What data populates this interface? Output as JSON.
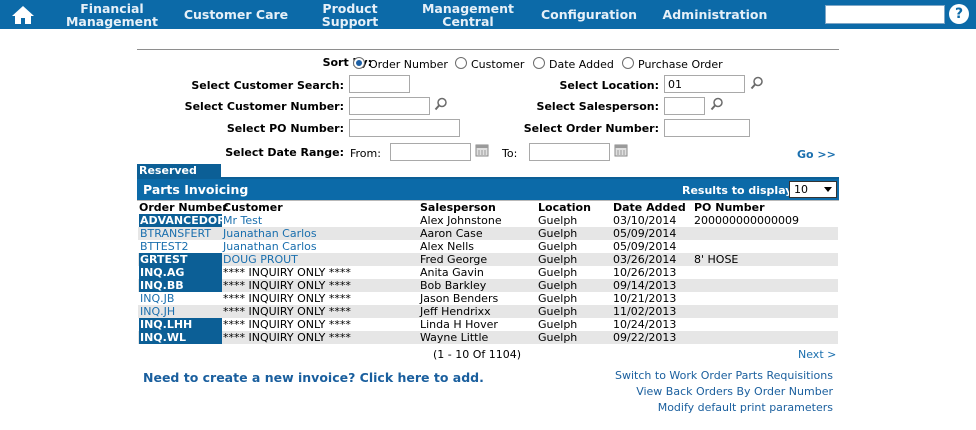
{
  "nav": {
    "items": [
      "Financial Management",
      "Customer Care",
      "Product Support",
      "Management Central",
      "Configuration",
      "Administration"
    ],
    "help_label": "?"
  },
  "sort": {
    "label": "Sort by:",
    "options": [
      "Order Number",
      "Customer",
      "Date Added",
      "Purchase Order"
    ],
    "selected": "Order Number"
  },
  "filters": {
    "customer_search_label": "Select Customer Search:",
    "customer_search_value": "",
    "customer_number_label": "Select Customer Number:",
    "customer_number_value": "",
    "po_number_label": "Select PO Number:",
    "po_number_value": "",
    "date_range_label": "Select Date Range:",
    "from_label": "From:",
    "from_value": "",
    "to_label": "To:",
    "to_value": "",
    "location_label": "Select Location:",
    "location_value": "01",
    "salesperson_label": "Select Salesperson:",
    "salesperson_value": "",
    "order_number_label": "Select Order Number:",
    "order_number_value": "",
    "go_label": "Go >>"
  },
  "grid": {
    "reserved_label": "Reserved",
    "title": "Parts Invoicing",
    "results_label": "Results to display:",
    "results_value": "10",
    "columns": [
      "Order Number",
      "Customer",
      "Salesperson",
      "Location",
      "Date Added",
      "PO Number"
    ],
    "rows": [
      {
        "order": "ADVANCEDOR",
        "customer": "Mr Test",
        "salesperson": "Alex Johnstone",
        "location": "Guelph",
        "date": "03/10/2014",
        "po": "200000000000009",
        "highlight": true,
        "alt": false,
        "link": true
      },
      {
        "order": "BTRANSFERT",
        "customer": "Juanathan Carlos",
        "salesperson": "Aaron Case",
        "location": "Guelph",
        "date": "05/09/2014",
        "po": "",
        "highlight": false,
        "alt": true,
        "link": true
      },
      {
        "order": "BTTEST2",
        "customer": "Juanathan Carlos",
        "salesperson": "Alex Nells",
        "location": "Guelph",
        "date": "05/09/2014",
        "po": "",
        "highlight": false,
        "alt": false,
        "link": true
      },
      {
        "order": "GRTEST",
        "customer": "DOUG PROUT",
        "salesperson": "Fred George",
        "location": "Guelph",
        "date": "03/26/2014",
        "po": "8' HOSE",
        "highlight": true,
        "alt": true,
        "link": true
      },
      {
        "order": "INQ.AG",
        "customer": "**** INQUIRY ONLY ****",
        "salesperson": "Anita Gavin",
        "location": "Guelph",
        "date": "10/26/2013",
        "po": "",
        "highlight": true,
        "alt": false,
        "link": false
      },
      {
        "order": "INQ.BB",
        "customer": "**** INQUIRY ONLY ****",
        "salesperson": "Bob Barkley",
        "location": "Guelph",
        "date": "09/14/2013",
        "po": "",
        "highlight": true,
        "alt": true,
        "link": false
      },
      {
        "order": "INQ.JB",
        "customer": "**** INQUIRY ONLY ****",
        "salesperson": "Jason Benders",
        "location": "Guelph",
        "date": "10/21/2013",
        "po": "",
        "highlight": false,
        "alt": false,
        "link": false
      },
      {
        "order": "INQ.JH",
        "customer": "**** INQUIRY ONLY ****",
        "salesperson": "Jeff Hendrixx",
        "location": "Guelph",
        "date": "11/02/2013",
        "po": "",
        "highlight": false,
        "alt": true,
        "link": false
      },
      {
        "order": "INQ.LHH",
        "customer": "**** INQUIRY ONLY ****",
        "salesperson": "Linda H Hover",
        "location": "Guelph",
        "date": "10/24/2013",
        "po": "",
        "highlight": true,
        "alt": false,
        "link": false
      },
      {
        "order": "INQ.WL",
        "customer": "**** INQUIRY ONLY ****",
        "salesperson": "Wayne Little",
        "location": "Guelph",
        "date": "09/22/2013",
        "po": "",
        "highlight": true,
        "alt": true,
        "link": false
      }
    ],
    "pager_text": "(1 - 10 Of 1104)",
    "next_label": "Next >"
  },
  "footer": {
    "add_invoice": "Need to create a new invoice? Click here to add.",
    "links": [
      "Switch to Work Order Parts Requisitions",
      "View Back Orders By Order Number",
      "Modify default print parameters"
    ]
  },
  "colors": {
    "nav_bg": "#0c6aa8",
    "highlight_bg": "#0c5f96",
    "link": "#1a6fae",
    "alt_row": "#e6e6e6"
  }
}
